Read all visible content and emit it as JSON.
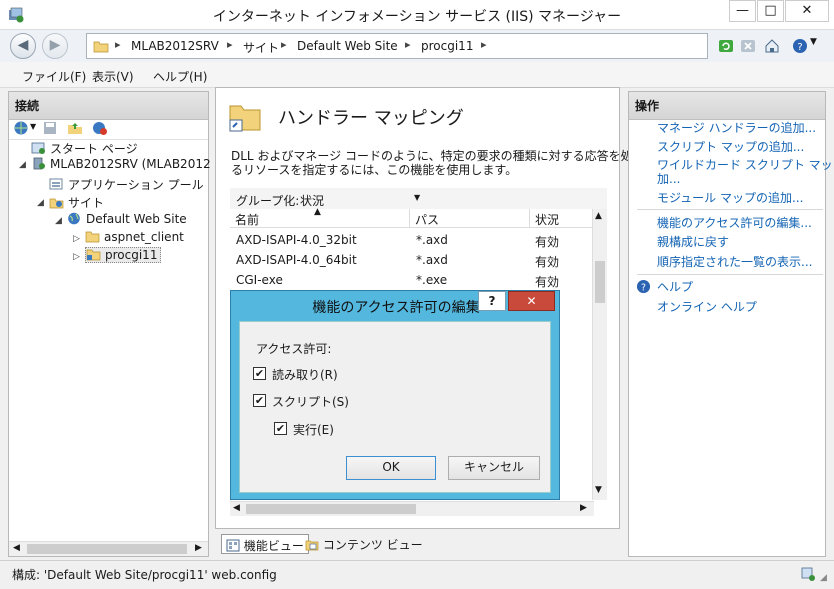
{
  "window": {
    "title": "インターネット インフォメーション サービス (IIS) マネージャー",
    "controls": {
      "minimize": "—",
      "maximize": "□",
      "close": "✕"
    },
    "icon": "iis-app-icon"
  },
  "address": {
    "segments": [
      "MLAB2012SRV",
      "サイト",
      "Default Web Site",
      "procgi11"
    ],
    "separator": "▸",
    "trailing": "▸"
  },
  "menu": [
    "ファイル(F)",
    "表示(V)",
    "ヘルプ(H)"
  ],
  "connections": {
    "header": "接続",
    "tree": [
      {
        "label": "スタート ページ"
      },
      {
        "label": "MLAB2012SRV (MLAB2012"
      },
      {
        "label": "アプリケーション プール"
      },
      {
        "label": "サイト"
      },
      {
        "label": "Default Web Site"
      },
      {
        "label": "aspnet_client"
      },
      {
        "label": "procgi11"
      }
    ]
  },
  "center": {
    "title": "ハンドラー マッピング",
    "description_line1": "DLL およびマネージ コードのように、特定の要求の種類に対する応答を処理す",
    "description_line2": "るリソースを指定するには、この機能を使用します。",
    "group_label": "グループ化:",
    "group_value": "状況",
    "columns": [
      "名前",
      "パス",
      "状況"
    ],
    "rows": [
      {
        "name": "AXD-ISAPI-4.0_32bit",
        "path": "*.axd",
        "state": "有効"
      },
      {
        "name": "AXD-ISAPI-4.0_64bit",
        "path": "*.axd",
        "state": "有効"
      },
      {
        "name": "CGI-exe",
        "path": "*.exe",
        "state": "有効"
      }
    ]
  },
  "dialog": {
    "title": "機能のアクセス許可の編集",
    "help": "?",
    "close": "✕",
    "group_label": "アクセス許可:",
    "read": "読み取り(R)",
    "script": "スクリプト(S)",
    "execute": "実行(E)",
    "check_mark": "✔",
    "ok": "OK",
    "cancel": "キャンセル"
  },
  "actions": {
    "header": "操作",
    "items": [
      "マネージ ハンドラーの追加...",
      "スクリプト マップの追加...",
      "ワイルドカード スクリプト マップの追",
      "加...",
      "モジュール マップの追加...",
      "機能のアクセス許可の編集...",
      "親構成に戻す",
      "順序指定された一覧の表示...",
      "ヘルプ",
      "オンライン ヘルプ"
    ]
  },
  "view_tabs": {
    "feature": "機能ビュー",
    "content": "コンテンツ ビュー"
  },
  "status": {
    "text": "構成: 'Default Web Site/procgi11' web.config"
  },
  "colors": {
    "dialog_frame": "#53b7de",
    "close_red": "#c9493a",
    "link": "#1464b4"
  }
}
